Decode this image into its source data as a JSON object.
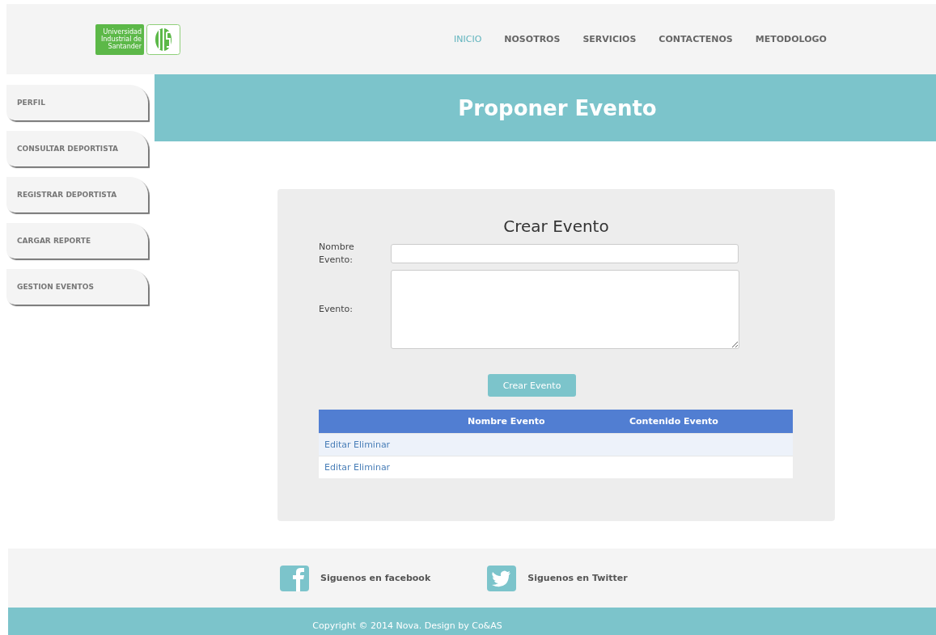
{
  "logo": {
    "text": "Universidad Industrial de Santander"
  },
  "nav": [
    {
      "label": "INICIO",
      "selected": true
    },
    {
      "label": "NOSOTROS",
      "selected": false
    },
    {
      "label": "SERVICIOS",
      "selected": false
    },
    {
      "label": "CONTACTENOS",
      "selected": false
    },
    {
      "label": "METODOLOGO",
      "selected": false
    }
  ],
  "sidebar": {
    "items": [
      "PERFIL",
      "CONSULTAR DEPORTISTA",
      "REGISTRAR DEPORTISTA",
      "CARGAR REPORTE",
      "GESTION EVENTOS"
    ]
  },
  "banner": {
    "title": "Proponer Evento"
  },
  "form": {
    "title": "Crear Evento",
    "name_label": "Nombre Evento:",
    "event_label": "Evento:",
    "submit": "Crear Evento"
  },
  "table": {
    "columns": [
      "Nombre Evento",
      "Contenido Evento"
    ],
    "rows": [
      {
        "actions": [
          "Editar",
          "Eliminar"
        ]
      },
      {
        "actions": [
          "Editar",
          "Eliminar"
        ]
      }
    ]
  },
  "footer": {
    "links": [
      {
        "kind": "facebook",
        "label": "Siguenos en facebook"
      },
      {
        "kind": "twitter",
        "label": "Siguenos en Twitter"
      }
    ],
    "copyright": "Copyright © 2014 Nova. Design by Co&AS"
  }
}
